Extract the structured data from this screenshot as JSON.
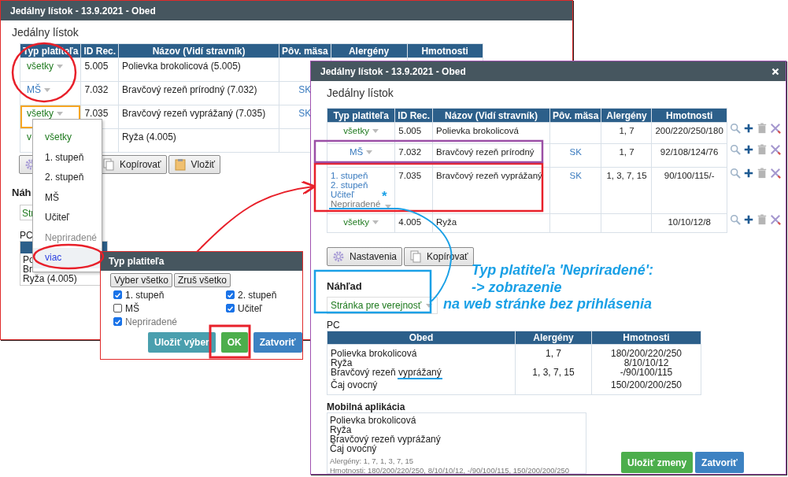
{
  "back_window": {
    "title": "Jedálny lístok - 13.9.2021 - Obed",
    "heading": "Jedálny lístok",
    "columns": [
      "Typ platiteľa",
      "ID Rec.",
      "Názov (Vidí stravník)",
      "Pôv. mäsa",
      "Alergény",
      "Hmotnosti"
    ],
    "rows": [
      {
        "payer": [
          {
            "text": "všetky",
            "kind": "all"
          }
        ],
        "id": "5.005",
        "name": "Polievka brokolicová (5.005)",
        "focused": false
      },
      {
        "payer": [
          {
            "text": "MŠ",
            "kind": "group"
          }
        ],
        "id": "7.032",
        "name": "Bravčový rezeň prírodný (7.032)",
        "meat": "SK",
        "focused": false
      },
      {
        "payer": [
          {
            "text": "všetky",
            "kind": "all"
          }
        ],
        "id": "7.035",
        "name": "Bravčový rezeň vyprážaný   (7.035)",
        "meat": "SK",
        "focused": true
      },
      {
        "payer": [
          {
            "text": "v",
            "kind": "all"
          }
        ],
        "name": "Ryža (4.005)",
        "focused": false
      }
    ],
    "buttons": [
      {
        "label": "Kopírovať"
      },
      {
        "label": "Vložiť"
      }
    ],
    "preview_heading": "Náh",
    "preview_select": "Str",
    "pc_label": "PC",
    "pc_lines": [
      "Po",
      "Br",
      "Ryža (4.005)"
    ]
  },
  "payer_menu": {
    "items": [
      {
        "label": "všetky",
        "kind": "all",
        "highlighted": false
      },
      {
        "label": "1. stupeň",
        "kind": "normal",
        "highlighted": false
      },
      {
        "label": "2. stupeň",
        "kind": "normal",
        "highlighted": false
      },
      {
        "label": "MŠ",
        "kind": "normal",
        "highlighted": false
      },
      {
        "label": "Učiteľ",
        "kind": "normal",
        "highlighted": false
      },
      {
        "label": "Nepriradené",
        "kind": "unassigned",
        "highlighted": false
      },
      {
        "label": "viac",
        "kind": "more",
        "highlighted": true
      }
    ]
  },
  "payer_dialog": {
    "title": "Typ platiteľa",
    "top_buttons": [
      "Vyber všetko",
      "Zruš všetko"
    ],
    "options": [
      {
        "label": "1. stupeň",
        "checked": true,
        "kind": "normal"
      },
      {
        "label": "2. stupeň",
        "checked": true,
        "kind": "normal"
      },
      {
        "label": "MŠ",
        "checked": false,
        "kind": "normal"
      },
      {
        "label": "Učiteľ",
        "checked": true,
        "kind": "normal"
      },
      {
        "label": "Nepriradené",
        "checked": true,
        "kind": "unassigned"
      }
    ],
    "buttons": [
      {
        "label": "Uložiť výber",
        "kind": "info"
      },
      {
        "label": "OK",
        "kind": "success"
      },
      {
        "label": "Zatvoriť",
        "kind": "primary"
      }
    ]
  },
  "front_window": {
    "title": "Jedálny lístok - 13.9.2021 - Obed",
    "heading": "Jedálny lístok",
    "columns": [
      "Typ platiteľa",
      "ID Rec.",
      "Názov (Vidí stravník)",
      "Pôv. mäsa",
      "Alergény",
      "Hmotnosti"
    ],
    "rows": [
      {
        "payer": [
          {
            "text": "všetky",
            "kind": "all"
          }
        ],
        "id": "5.005",
        "name": "Polievka brokolicová",
        "allergens": "1, 7",
        "weights": "200/220/250/180"
      },
      {
        "payer": [
          {
            "text": "MŠ",
            "kind": "group"
          }
        ],
        "id": "7.032",
        "name": "Bravčový rezeň prírodný",
        "meat": "SK",
        "allergens": "1, 7",
        "weights": "92/108/124/76"
      },
      {
        "payer": [
          {
            "text": "1. stupeň",
            "kind": "group"
          },
          {
            "text": "2. stupeň",
            "kind": "group"
          },
          {
            "text": "Učiteľ",
            "kind": "group"
          },
          {
            "text": "Nepriradené",
            "kind": "unassigned"
          }
        ],
        "id": "7.035",
        "name": "Bravčový rezeň vyprážaný",
        "meat": "SK",
        "allergens": "1, 3, 7, 15",
        "weights": "90/100/115/-"
      },
      {
        "payer": [
          {
            "text": "všetky",
            "kind": "all"
          }
        ],
        "id": "4.005",
        "name": "Ryža",
        "weights": "10/10/12/8"
      }
    ],
    "buttons": [
      {
        "label": "Nastavenia"
      },
      {
        "label": "Kopírovať"
      }
    ],
    "preview_heading": "Náhľad",
    "preview_select": "Stránka pre verejnosť",
    "pc_label": "PC",
    "pc_columns": [
      "Obed",
      "Alergény",
      "Hmotnosti"
    ],
    "pc_rows": [
      {
        "dish": "Polievka brokolicová",
        "allergens": "1, 7",
        "weights": "180/200/220/250"
      },
      {
        "dish": "Ryža",
        "weights": "8/10/10/12"
      },
      {
        "dish": "Bravčový rezeň vyprážaný",
        "allergens": "1, 3, 7, 15",
        "weights": "-/90/100/115"
      },
      {
        "dish": "Čaj ovocný",
        "weights": "150/200/200/250"
      }
    ],
    "mobile_label": "Mobilná aplikácia",
    "mobile_lines": [
      "Polievka brokolicová",
      "Ryža",
      "Bravčový rezeň vyprážaný",
      "Čaj ovocný"
    ],
    "mobile_notes": [
      "Alergény: 1, 7, 1, 3, 7, 15",
      "Hmotnosti: 180/200/220/250, 8/10/10/12, -/90/100/115, 150/200/200/250"
    ],
    "footer_buttons": [
      {
        "label": "Uložiť zmeny",
        "kind": "success"
      },
      {
        "label": "Zatvoriť",
        "kind": "primary"
      }
    ]
  },
  "annotation": {
    "marker": "*",
    "lines": [
      "Typ platiteľa 'Nepriradené':",
      "-> zobrazenie",
      "na web stránke bez prihlásenia"
    ]
  }
}
